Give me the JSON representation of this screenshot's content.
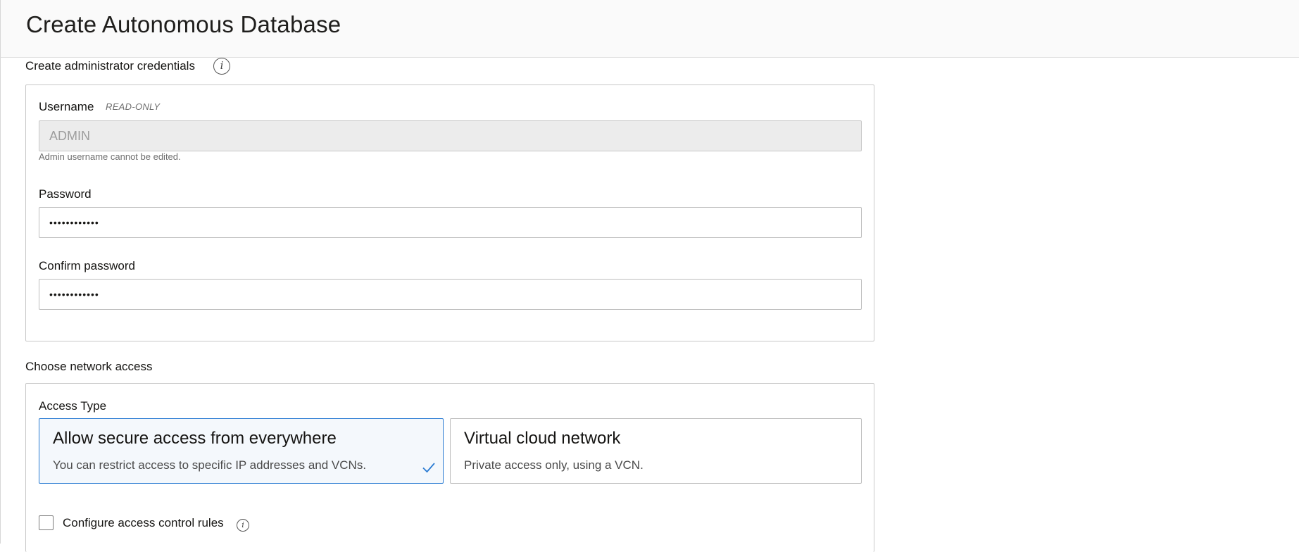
{
  "page": {
    "title": "Create Autonomous Database"
  },
  "credentials": {
    "section_title": "Create administrator credentials",
    "info_icon": "info-icon",
    "username": {
      "label": "Username",
      "readonly_tag": "READ-ONLY",
      "value": "ADMIN",
      "helper": "Admin username cannot be edited."
    },
    "password": {
      "label": "Password",
      "value": "••••••••••••"
    },
    "confirm_password": {
      "label": "Confirm password",
      "value": "••••••••••••"
    }
  },
  "network": {
    "section_title": "Choose network access",
    "access_type_label": "Access Type",
    "options": [
      {
        "title": "Allow secure access from everywhere",
        "description": "You can restrict access to specific IP addresses and VCNs.",
        "selected": true
      },
      {
        "title": "Virtual cloud network",
        "description": "Private access only, using a VCN.",
        "selected": false
      }
    ],
    "access_control": {
      "label": "Configure access control rules",
      "checked": false
    }
  },
  "colors": {
    "accent": "#2b7cd3",
    "selected_bg": "#f4f8fc",
    "readonly_bg": "#ececec"
  }
}
